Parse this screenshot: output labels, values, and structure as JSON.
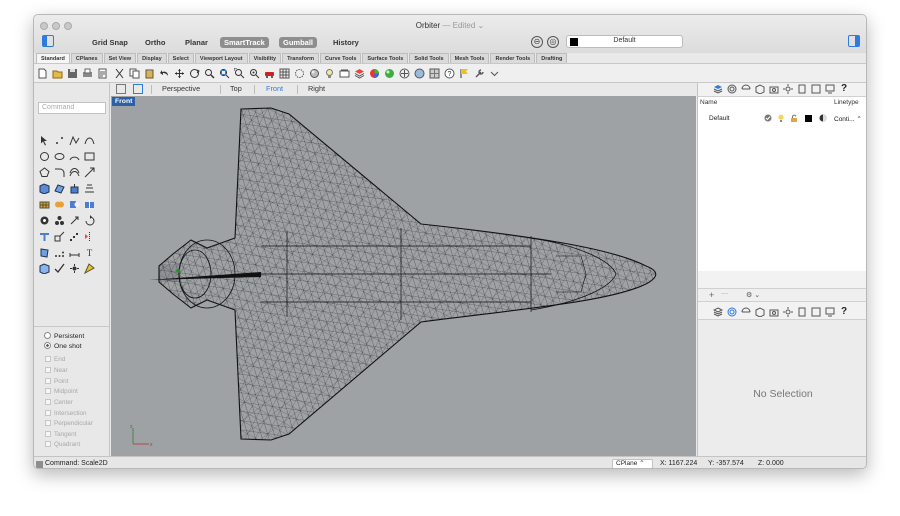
{
  "window": {
    "title": "Orbiter",
    "edited": "— Edited ⌄"
  },
  "modes": [
    {
      "label": "Grid Snap",
      "active": false
    },
    {
      "label": "Ortho",
      "active": false
    },
    {
      "label": "Planar",
      "active": false
    },
    {
      "label": "SmartTrack",
      "active": true
    },
    {
      "label": "Gumball",
      "active": true
    },
    {
      "label": "History",
      "active": false
    }
  ],
  "layer_selector": {
    "value": "Default",
    "swatch": "#000000"
  },
  "tool_tabs": [
    "Standard",
    "CPlanes",
    "Set View",
    "Display",
    "Select",
    "Viewport Layout",
    "Visibility",
    "Transform",
    "Curve Tools",
    "Surface Tools",
    "Solid Tools",
    "Mesh Tools",
    "Render Tools",
    "Drafting"
  ],
  "active_tool_tab": "Standard",
  "command_input": {
    "placeholder": "Command"
  },
  "osnap": {
    "modes": [
      "Persistent",
      "One shot"
    ],
    "selected": "One shot",
    "snaps": [
      "End",
      "Near",
      "Point",
      "Midpoint",
      "Center",
      "Intersection",
      "Perpendicular",
      "Tangent",
      "Quadrant"
    ]
  },
  "viewport_tabs": {
    "items": [
      "Perspective",
      "Top",
      "Front",
      "Right"
    ],
    "active": "Front"
  },
  "viewport": {
    "label": "Front",
    "background": "#9fa2a5"
  },
  "layers_panel": {
    "columns": {
      "name": "Name",
      "linetype": "Linetype"
    },
    "rows": [
      {
        "name": "Default",
        "linetype": "Conti... ⌃"
      }
    ],
    "add_label": "+",
    "minus_label": "—",
    "gear_label": "⚙ ⌄"
  },
  "properties_panel": {
    "empty_text": "No Selection"
  },
  "status": {
    "command": "Command: Scale2D",
    "cplane": "CPlane ⌃",
    "x": "X: 1167.224",
    "y": "Y: -357.574",
    "z": "Z: 0.000"
  }
}
